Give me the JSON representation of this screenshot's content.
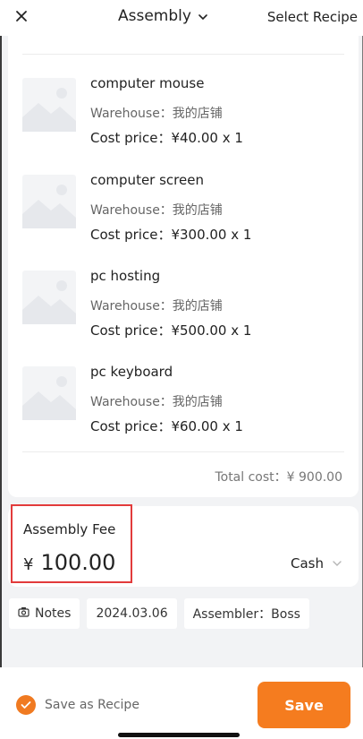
{
  "header": {
    "title": "Assembly",
    "select_recipe": "Select Recipe"
  },
  "items": [
    {
      "name": "computer mouse",
      "warehouse": "Warehouse：我的店铺",
      "cost": "Cost price：¥40.00 x 1"
    },
    {
      "name": "computer screen",
      "warehouse": "Warehouse：我的店铺",
      "cost": "Cost price：¥300.00 x 1"
    },
    {
      "name": "pc hosting",
      "warehouse": "Warehouse：我的店铺",
      "cost": "Cost price：¥500.00 x 1"
    },
    {
      "name": "pc keyboard",
      "warehouse": "Warehouse：我的店铺",
      "cost": "Cost price：¥60.00 x 1"
    }
  ],
  "total_cost": "Total cost：¥ 900.00",
  "fee": {
    "label": "Assembly Fee",
    "currency": "¥",
    "amount": "100.00",
    "payment_method": "Cash"
  },
  "chips": {
    "notes": "Notes",
    "date": "2024.03.06",
    "assembler": "Assembler：Boss"
  },
  "footer": {
    "save_as_recipe": "Save as Recipe",
    "save": "Save"
  },
  "colors": {
    "accent": "#f57c1f",
    "highlight": "#e23b3b"
  }
}
